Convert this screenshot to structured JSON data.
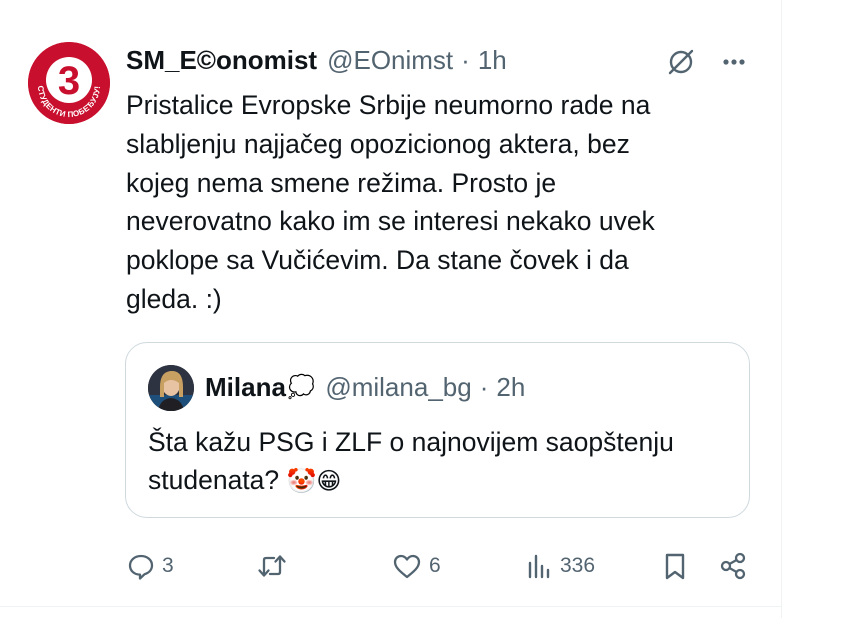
{
  "tweet": {
    "author_name": "SM_E©onomist",
    "handle": "@EOnimst",
    "separator": "·",
    "time": "1h",
    "text": "Pristalice Evropske Srbije neumorno rade na\nslabljenju najjačeg opozicionog aktera, bez\nkojeg nema smene režima. Prosto je\nneverovatno kako im se interesi nekako uvek\npoklope sa Vučićevim. Da stane čovek i da\ngleda. :)",
    "avatar": {
      "number": "3",
      "ring_text": "СТУДЕНТИ ПОБЕЂУЈУ!",
      "color": "#c8102e"
    },
    "grok_icon": "grok-icon",
    "more_icon": "more-horizontal-icon"
  },
  "quote": {
    "author_name": "Milana",
    "name_emoji": "💭",
    "handle": "@milana_bg",
    "separator": "·",
    "time": "2h",
    "text": "Šta kažu PSG i ZLF o najnovijem saopštenju studenata?",
    "text_emojis": "🤡😁"
  },
  "actions": {
    "replies": "3",
    "reposts": "",
    "likes": "6",
    "views": "336"
  },
  "colors": {
    "text_primary": "#0f1419",
    "text_secondary": "#536471",
    "border": "#cfd9de",
    "brand_red": "#c8102e"
  }
}
